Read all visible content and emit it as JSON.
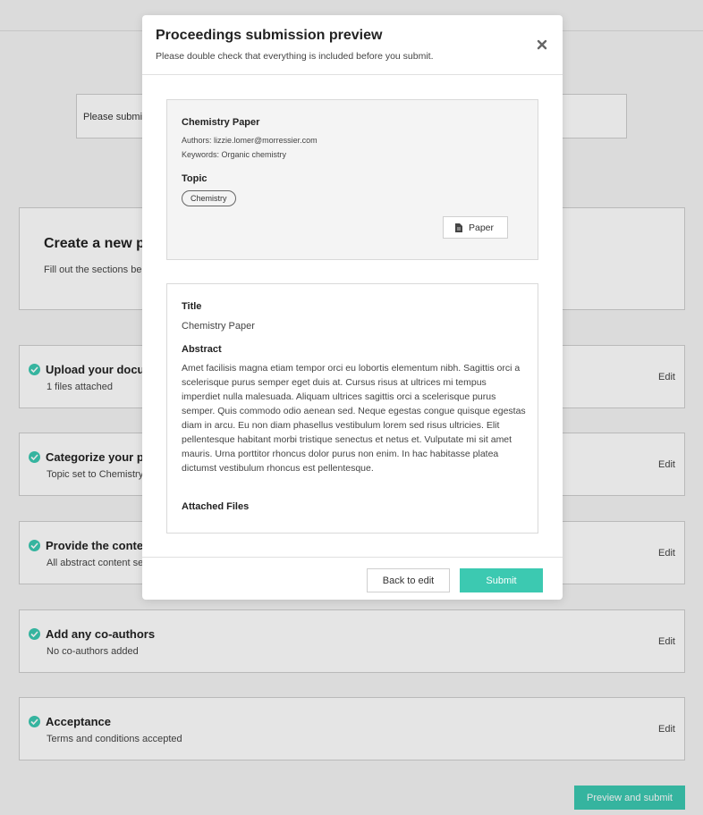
{
  "background": {
    "notice_text": "Please submit",
    "create": {
      "title": "Create a new p",
      "subtitle": "Fill out the sections be"
    },
    "steps": [
      {
        "title": "Upload your docu",
        "subtitle": "1 files attached",
        "edit_label": "Edit"
      },
      {
        "title": "Categorize your pa",
        "subtitle": "Topic set to Chemistry",
        "edit_label": "Edit"
      },
      {
        "title": "Provide the conte",
        "subtitle": "All abstract content se",
        "edit_label": "Edit"
      },
      {
        "title": "Add any co-authors",
        "subtitle": "No co-authors added",
        "edit_label": "Edit"
      },
      {
        "title": "Acceptance",
        "subtitle": "Terms and conditions accepted",
        "edit_label": "Edit"
      }
    ],
    "preview_button": "Preview and submit"
  },
  "modal": {
    "title": "Proceedings submission preview",
    "subtitle": "Please double check that everything is included before you submit.",
    "close_icon": "close-icon",
    "paper": {
      "title": "Chemistry Paper",
      "authors": "Authors: lizzie.lomer@morressier.com",
      "keywords": "Keywords: Organic chemistry",
      "topic_label": "Topic",
      "topic": "Chemistry",
      "file_button": "Paper",
      "file_icon": "file-icon"
    },
    "details": {
      "title_label": "Title",
      "title_value": "Chemistry Paper",
      "abstract_label": "Abstract",
      "abstract_text": "Amet facilisis magna etiam tempor orci eu lobortis elementum nibh. Sagittis orci a scelerisque purus semper eget duis at. Cursus risus at ultrices mi tempus imperdiet nulla malesuada. Aliquam ultrices sagittis orci a scelerisque purus semper. Quis commodo odio aenean sed. Neque egestas congue quisque egestas diam in arcu. Eu non diam phasellus vestibulum lorem sed risus ultricies. Elit pellentesque habitant morbi tristique senectus et netus et. Vulputate mi sit amet mauris. Urna porttitor rhoncus dolor purus non enim. In hac habitasse platea dictumst vestibulum rhoncus est pellentesque.",
      "attached_files_label": "Attached Files"
    },
    "footer": {
      "back_button": "Back to edit",
      "submit_button": "Submit"
    }
  },
  "colors": {
    "accent": "#3cc9b1",
    "border": "#cfcfcf"
  }
}
